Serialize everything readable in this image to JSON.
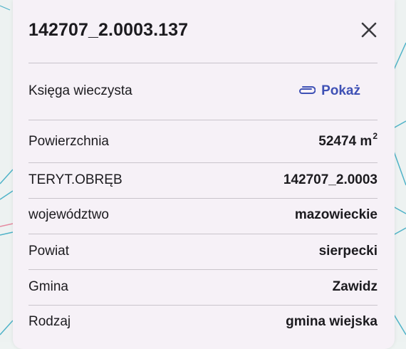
{
  "parcel": {
    "title": "142707_2.0003.137"
  },
  "land_register": {
    "label": "Księga wieczysta",
    "link_label": "Pokaż"
  },
  "attributes": [
    {
      "label": "Powierzchnia",
      "value": "52474 m",
      "sup": "2"
    },
    {
      "label": "TERYT.OBRĘB",
      "value": "142707_2.0003"
    },
    {
      "label": "województwo",
      "value": "mazowieckie"
    },
    {
      "label": "Powiat",
      "value": "sierpecki"
    },
    {
      "label": "Gmina",
      "value": "Zawidz"
    },
    {
      "label": "Rodzaj",
      "value": "gmina wiejska"
    }
  ],
  "colors": {
    "accent": "#3f51b5",
    "card_bg": "#f6f1f7",
    "divider": "#c9c4cb",
    "map_line": "#4fb3c8"
  },
  "icons": {
    "close": "close-icon",
    "attachment": "paperclip-icon"
  }
}
